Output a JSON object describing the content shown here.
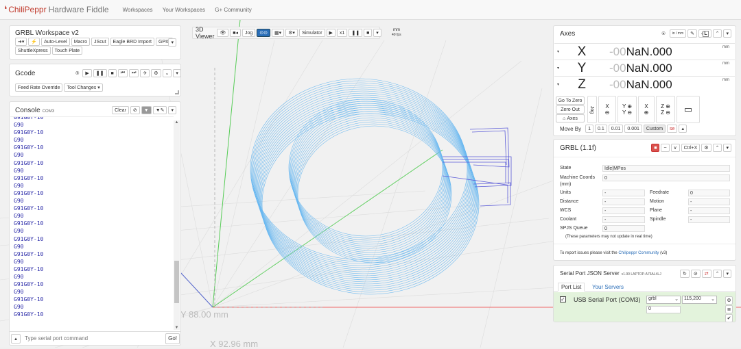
{
  "nav": {
    "brand_prefix": "ChiliPeppr",
    "brand_title": "Hardware Fiddle",
    "links": [
      "Workspaces",
      "Your Workspaces",
      "G+ Community"
    ]
  },
  "workspace": {
    "title": "GRBL Workspace v2",
    "buttons": [
      "Auto-Level",
      "Macro",
      "JScut",
      "Eagle BRD Import",
      "GPIO",
      "ShuttleXpress",
      "Touch Plate"
    ]
  },
  "gcode": {
    "title": "Gcode",
    "feed_rate_override": "Feed Rate Override",
    "tool_changes": "Tool Changes"
  },
  "console": {
    "title": "Console",
    "port": "COM3",
    "clear_label": "Clear",
    "lines": [
      "G91G0Y-10",
      "G90",
      "G91G0Y-10",
      "G90",
      "G91G0Y-10",
      "G90",
      "G91G0Y-10",
      "G90",
      "G91G0Y-10",
      "G90",
      "G91G0Y-10",
      "G90",
      "G91G0Y-10",
      "G90",
      "G91G0Y-10",
      "G90",
      "G91G0Y-10",
      "G90",
      "G91G0Y-10",
      "G90",
      "G91G0Y-10",
      "G90",
      "G91G0Y-10",
      "G90",
      "G91G0Y-10",
      "G90",
      "G91G0Y-10"
    ],
    "input_placeholder": "Type serial port command",
    "go_label": "Go!"
  },
  "viewer": {
    "title": "3D Viewer",
    "jog_label": "Jog",
    "simulator_label": "Simulator",
    "speed": "x1",
    "unit": "mm",
    "fps": "40 fps",
    "label_y": "Y 88.00 mm",
    "label_x": "X 92.96 mm"
  },
  "axes": {
    "title": "Axes",
    "units_btn": "in / mm",
    "l_btn": "L",
    "rows": [
      {
        "axis": "X",
        "neg": "-00",
        "value": "NaN.000",
        "unit": "mm"
      },
      {
        "axis": "Y",
        "neg": "-00",
        "value": "NaN.000",
        "unit": "mm"
      },
      {
        "axis": "Z",
        "neg": "-00",
        "value": "NaN.000",
        "unit": "mm"
      }
    ],
    "go_to_zero": "Go To Zero",
    "zero_out": "Zero Out",
    "axes_btn": "Axes",
    "jog_label": "Jog",
    "move_by_label": "Move By",
    "move_by_options": [
      "1",
      "0.1",
      "0.01",
      "0.001",
      "Custom"
    ],
    "custom_value": "se"
  },
  "grbl": {
    "title": "GRBL (1.1f)",
    "ctrlx": "Ctrl+X",
    "state_label": "State",
    "state_value": "Idle|MPos",
    "machine_coords_label": "Machine Coords (mm)",
    "machine_coords_value": "0",
    "units_label": "Units",
    "units_value": "-",
    "feedrate_label": "Feedrate",
    "feedrate_value": "0",
    "distance_label": "Distance",
    "distance_value": "-",
    "motion_label": "Motion",
    "motion_value": "-",
    "wcs_label": "WCS",
    "wcs_value": "-",
    "plane_label": "Plane",
    "plane_value": "-",
    "coolant_label": "Coolant",
    "coolant_value": "-",
    "spindle_label": "Spindle",
    "spindle_value": "-",
    "queue_label": "SPJS Queue",
    "queue_value": "0",
    "note": "(These parameters may not update in real time)",
    "report_text": "To report issues please visit the",
    "report_link": "Chilipeppr Community",
    "report_ver": "(v3)"
  },
  "serial": {
    "title": "Serial Port JSON Server",
    "version": "v1.90 LAPTOP-A76AL4LJ",
    "tab_port_list": "Port List",
    "tab_servers": "Your Servers",
    "port_name": "USB Serial Port (COM3)",
    "buffer": "grbl",
    "baud": "115,200",
    "count": "0"
  },
  "colors": {
    "accent": "#2a6eb8",
    "toolpath": "#6ab8f0",
    "axis_red": "#e55",
    "axis_green": "#4c4",
    "axis_blue": "#46c",
    "serial_bg": "#e3f3dc"
  }
}
